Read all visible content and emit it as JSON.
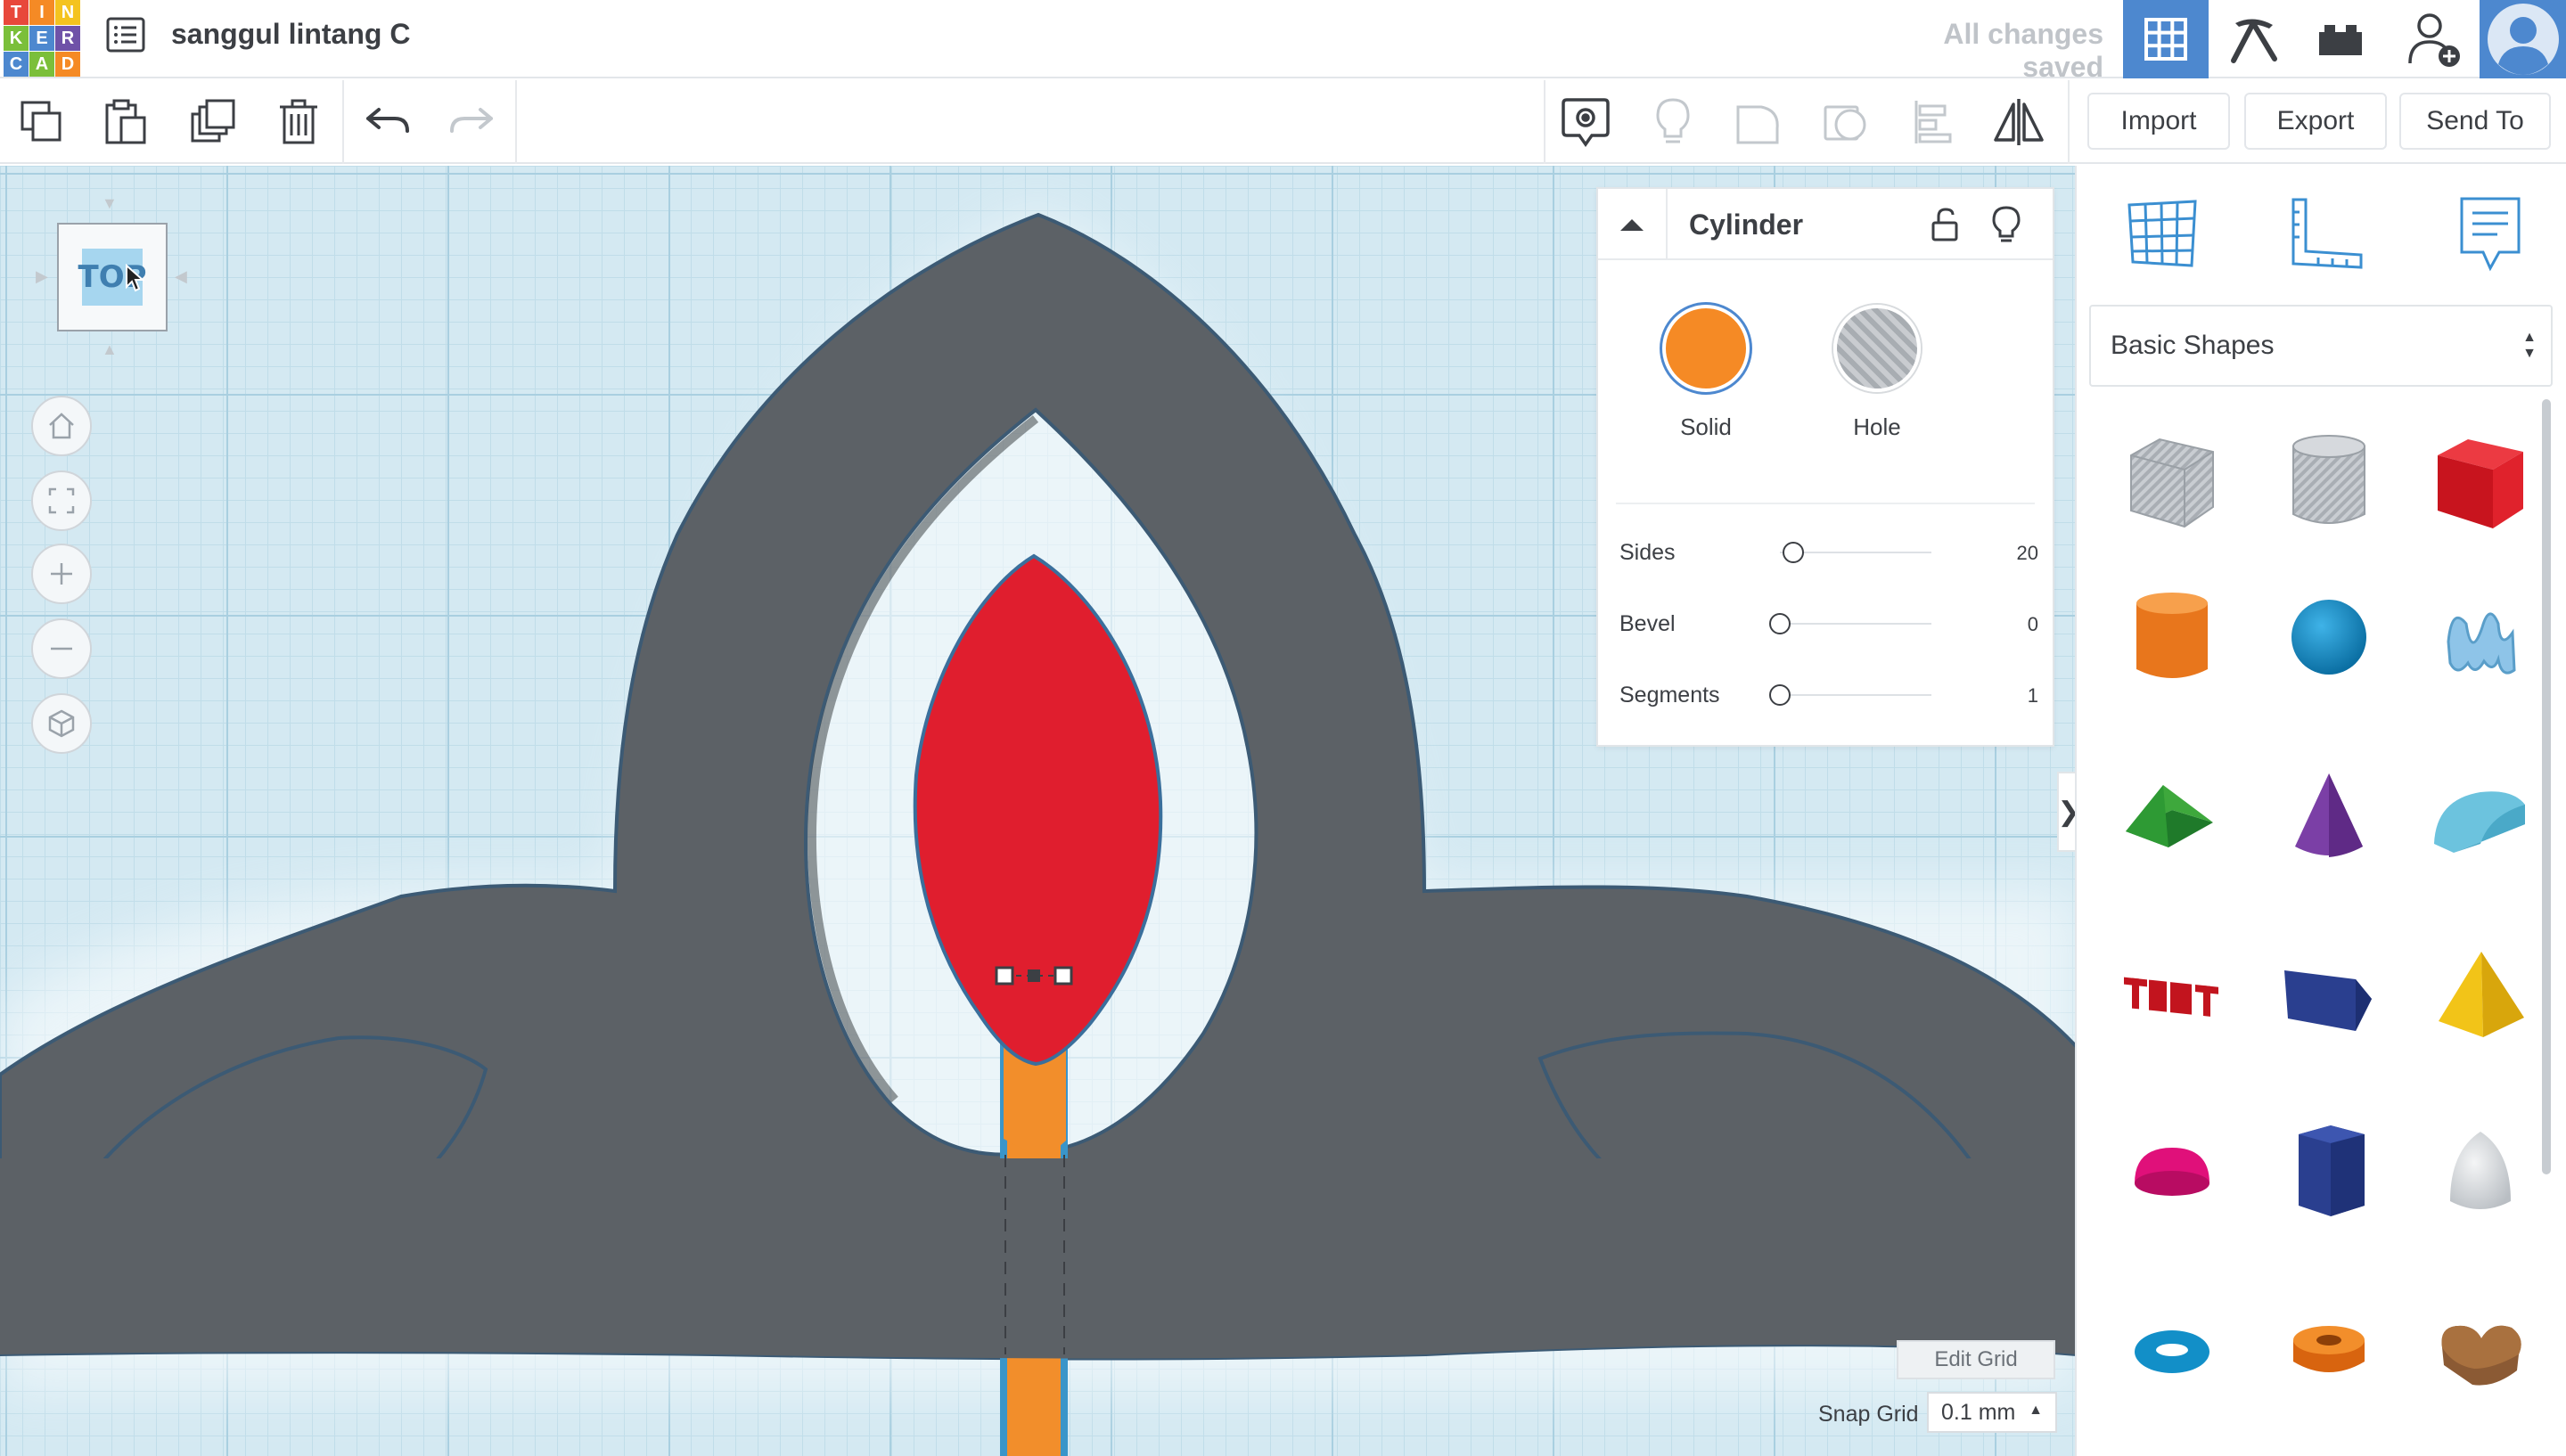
{
  "app": {
    "logo_letters": [
      "T",
      "I",
      "N",
      "K",
      "E",
      "R",
      "C",
      "A",
      "D"
    ],
    "design_title": "sanggul lintang C",
    "save_status": "All changes saved"
  },
  "colors": {
    "accent_blue": "#4d88cf",
    "logo": [
      "#e8483b",
      "#f58a25",
      "#f4c31f",
      "#7bbf3a",
      "#4d88cf",
      "#6f52a8",
      "#4d88cf",
      "#7bbf3a",
      "#f58a25"
    ],
    "solid": "#f58a25",
    "workplane": "#d4e9f2",
    "gray_shape": "#5c6166",
    "red_shape": "#e01e2e"
  },
  "toolbar": {
    "import_label": "Import",
    "export_label": "Export",
    "send_to_label": "Send To",
    "icons": [
      "copy-icon",
      "paste-icon",
      "duplicate-icon",
      "trash-icon",
      "undo-icon",
      "redo-icon",
      "note-icon",
      "lightbulb-icon",
      "group-icon",
      "ungroup-icon",
      "align-icon",
      "mirror-icon"
    ]
  },
  "viewcube": {
    "face_label": "TOP"
  },
  "workplane": {
    "edit_grid_label": "Edit Grid",
    "snap_grid_label": "Snap Grid",
    "snap_grid_value": "0.1 mm"
  },
  "inspector": {
    "title": "Cylinder",
    "solid_label": "Solid",
    "hole_label": "Hole",
    "params": [
      {
        "name": "Sides",
        "value": "20",
        "fraction": 0.09
      },
      {
        "name": "Bevel",
        "value": "0",
        "fraction": 0.0
      },
      {
        "name": "Segments",
        "value": "1",
        "fraction": 0.0
      }
    ]
  },
  "library": {
    "category": "Basic Shapes",
    "shapes": [
      "box-hole",
      "cylinder-hole",
      "box",
      "cylinder",
      "sphere",
      "scribble",
      "roof",
      "cone",
      "round-roof",
      "text",
      "wedge",
      "pyramid",
      "half-sphere",
      "polygon",
      "paraboloid",
      "torus",
      "tube",
      "heart"
    ]
  }
}
